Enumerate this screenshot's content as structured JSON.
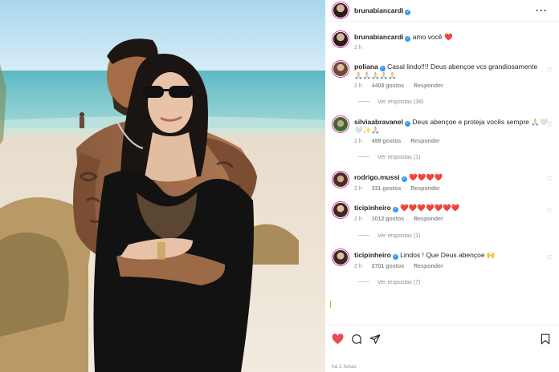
{
  "post": {
    "author": "brunabiancardi",
    "caption_author": "brunabiancardi",
    "caption_text": "amo você",
    "caption_emoji": "❤️",
    "caption_time": "2 h",
    "more_icon": "more-dots-icon",
    "time_ago": "há 2 horas"
  },
  "comments": [
    {
      "user": "poliana",
      "text": "Casal lindo!!!! Deus abençoe vcs grandiosamente",
      "text_line2": "🙏🏻🙏🏻🙏🏻🙏🏻🙏🏻",
      "time": "2 h",
      "likes": "4408 gostos",
      "reply": "Responder",
      "replies": "Ver respostas (38)"
    },
    {
      "user": "silviaabravanel",
      "text": "Deus abençoe e proteja vocês sempre 🙏🏻🤍",
      "text_line2": "🤍✨🙏🏻",
      "time": "2 h",
      "likes": "499 gostos",
      "reply": "Responder",
      "replies": "Ver respostas (1)"
    },
    {
      "user": "rodrigo.mussi",
      "text": "❤️❤️❤️❤️",
      "time": "2 h",
      "likes": "331 gostos",
      "reply": "Responder"
    },
    {
      "user": "ticipinheiro",
      "text": "❤️❤️❤️❤️❤️❤️❤️",
      "time": "2 h",
      "likes": "1012 gostos",
      "reply": "Responder",
      "replies": "Ver respostas (1)"
    },
    {
      "user": "ticipinheiro",
      "text": "Lindos ! Que Deus abençoe 🙌",
      "time": "2 h",
      "likes": "2701 gostos",
      "reply": "Responder",
      "replies": "Ver respostas (7)"
    }
  ],
  "actions": {
    "like_icon": "heart-filled-icon",
    "comment_icon": "comment-icon",
    "share_icon": "share-icon",
    "save_icon": "bookmark-icon"
  },
  "colors": {
    "verified": "#3897f0",
    "like_red": "#ed4956",
    "muted": "#8e8e8e",
    "text": "#262626"
  }
}
